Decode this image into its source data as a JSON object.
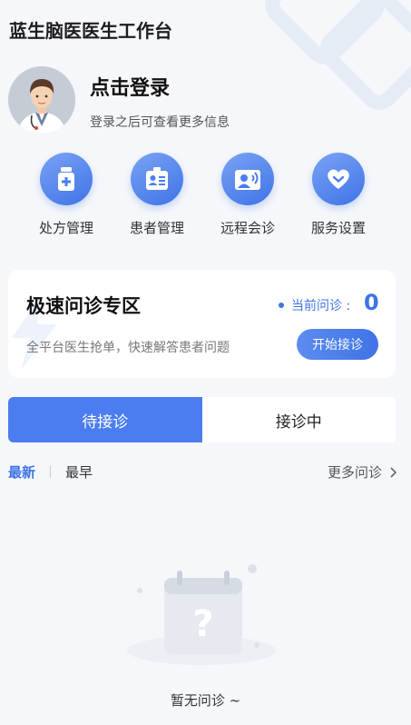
{
  "header": {
    "title": "蓝生脑医医生工作台"
  },
  "profile": {
    "login_title": "点击登录",
    "login_subtitle": "登录之后可查看更多信息"
  },
  "quick_menu": {
    "items": [
      {
        "label": "处方管理",
        "icon": "medicine-bottle-icon"
      },
      {
        "label": "患者管理",
        "icon": "patient-card-icon"
      },
      {
        "label": "远程会诊",
        "icon": "remote-consult-icon"
      },
      {
        "label": "服务设置",
        "icon": "heart-settings-icon"
      }
    ]
  },
  "quick_consult": {
    "title": "极速问诊专区",
    "description": "全平台医生抢单，快速解答患者问题",
    "current_label": "当前问诊 :",
    "current_count": "0",
    "start_button": "开始接诊"
  },
  "tabs": {
    "items": [
      {
        "label": "待接诊",
        "active": true
      },
      {
        "label": "接诊中",
        "active": false
      }
    ]
  },
  "sort_bar": {
    "latest": "最新",
    "earliest": "最早",
    "more": "更多问诊"
  },
  "empty_state": {
    "text": "暂无问诊 ~"
  },
  "colors": {
    "accent": "#3f73e6",
    "accent_light": "#7aa3f5",
    "background": "#f5f7fa"
  }
}
